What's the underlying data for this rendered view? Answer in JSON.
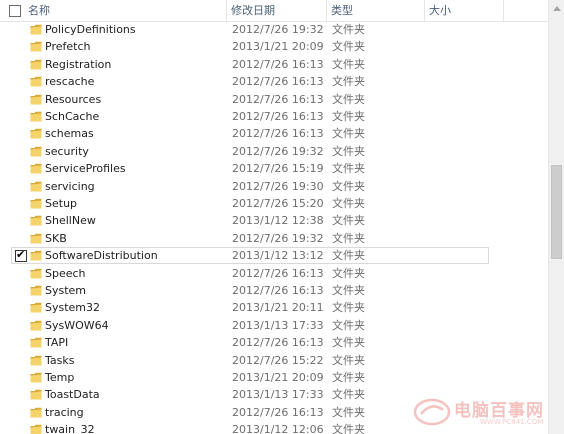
{
  "header": {
    "name_label": "名称",
    "date_label": "修改日期",
    "type_label": "类型",
    "size_label": "大小"
  },
  "rows": [
    {
      "name": "PolicyDefinitions",
      "date": "2012/7/26 19:32",
      "type": "文件夹",
      "checked": false
    },
    {
      "name": "Prefetch",
      "date": "2013/1/21 20:09",
      "type": "文件夹",
      "checked": false
    },
    {
      "name": "Registration",
      "date": "2012/7/26 16:13",
      "type": "文件夹",
      "checked": false
    },
    {
      "name": "rescache",
      "date": "2012/7/26 16:13",
      "type": "文件夹",
      "checked": false
    },
    {
      "name": "Resources",
      "date": "2012/7/26 16:13",
      "type": "文件夹",
      "checked": false
    },
    {
      "name": "SchCache",
      "date": "2012/7/26 16:13",
      "type": "文件夹",
      "checked": false
    },
    {
      "name": "schemas",
      "date": "2012/7/26 16:13",
      "type": "文件夹",
      "checked": false
    },
    {
      "name": "security",
      "date": "2012/7/26 19:32",
      "type": "文件夹",
      "checked": false
    },
    {
      "name": "ServiceProfiles",
      "date": "2012/7/26 15:19",
      "type": "文件夹",
      "checked": false
    },
    {
      "name": "servicing",
      "date": "2012/7/26 19:30",
      "type": "文件夹",
      "checked": false
    },
    {
      "name": "Setup",
      "date": "2012/7/26 15:20",
      "type": "文件夹",
      "checked": false
    },
    {
      "name": "ShellNew",
      "date": "2013/1/12 12:38",
      "type": "文件夹",
      "checked": false
    },
    {
      "name": "SKB",
      "date": "2012/7/26 19:32",
      "type": "文件夹",
      "checked": false
    },
    {
      "name": "SoftwareDistribution",
      "date": "2013/1/12 13:12",
      "type": "文件夹",
      "checked": true
    },
    {
      "name": "Speech",
      "date": "2012/7/26 16:13",
      "type": "文件夹",
      "checked": false
    },
    {
      "name": "System",
      "date": "2012/7/26 16:13",
      "type": "文件夹",
      "checked": false
    },
    {
      "name": "System32",
      "date": "2013/1/21 20:11",
      "type": "文件夹",
      "checked": false
    },
    {
      "name": "SysWOW64",
      "date": "2013/1/13 17:33",
      "type": "文件夹",
      "checked": false
    },
    {
      "name": "TAPI",
      "date": "2012/7/26 16:13",
      "type": "文件夹",
      "checked": false
    },
    {
      "name": "Tasks",
      "date": "2012/7/26 15:22",
      "type": "文件夹",
      "checked": false
    },
    {
      "name": "Temp",
      "date": "2013/1/21 20:09",
      "type": "文件夹",
      "checked": false
    },
    {
      "name": "ToastData",
      "date": "2013/1/13 17:33",
      "type": "文件夹",
      "checked": false
    },
    {
      "name": "tracing",
      "date": "2012/7/26 16:13",
      "type": "文件夹",
      "checked": false
    },
    {
      "name": "twain_32",
      "date": "2013/1/12 12:06",
      "type": "文件夹",
      "checked": false
    }
  ],
  "watermark": {
    "text": "电脑百事网",
    "subtext": "WWW.PC841.COM"
  },
  "colors": {
    "folder_fill": "#f4d36b",
    "folder_edge": "#d9a93a",
    "header_text": "#4c607a",
    "meta_text": "#6d6d6d"
  }
}
